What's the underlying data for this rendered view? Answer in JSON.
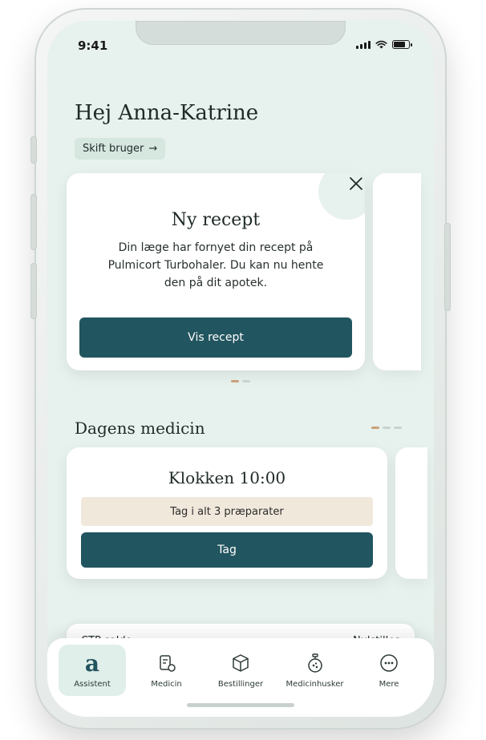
{
  "status_bar": {
    "time": "9:41"
  },
  "header": {
    "greeting": "Hej Anna-Katrine",
    "switch_user_label": "Skift bruger",
    "switch_user_arrow": "→"
  },
  "notice": {
    "title": "Ny recept",
    "body": "Din læge har fornyet din recept på Pulmicort Turbohaler. Du kan nu hente den på dit apotek.",
    "button_label": "Vis recept"
  },
  "daily_medicine": {
    "section_title": "Dagens medicin",
    "time_label": "Klokken 10:00",
    "summary": "Tag i alt 3 præparater",
    "button_label": "Tag"
  },
  "ctp": {
    "label": "CTP saldo",
    "action": "Nulstilles"
  },
  "tabbar": {
    "items": [
      {
        "label": "Assistent",
        "icon": "a",
        "active": true
      },
      {
        "label": "Medicin",
        "icon": "prescription-icon",
        "active": false
      },
      {
        "label": "Bestillinger",
        "icon": "box-icon",
        "active": false
      },
      {
        "label": "Medicinhusker",
        "icon": "reminder-icon",
        "active": false
      },
      {
        "label": "Mere",
        "icon": "more-icon",
        "active": false
      }
    ]
  },
  "colors": {
    "primary": "#21555f",
    "background": "#e7f1ed",
    "accent": "#c9a27a",
    "badge_bg": "#f1e8dc"
  }
}
